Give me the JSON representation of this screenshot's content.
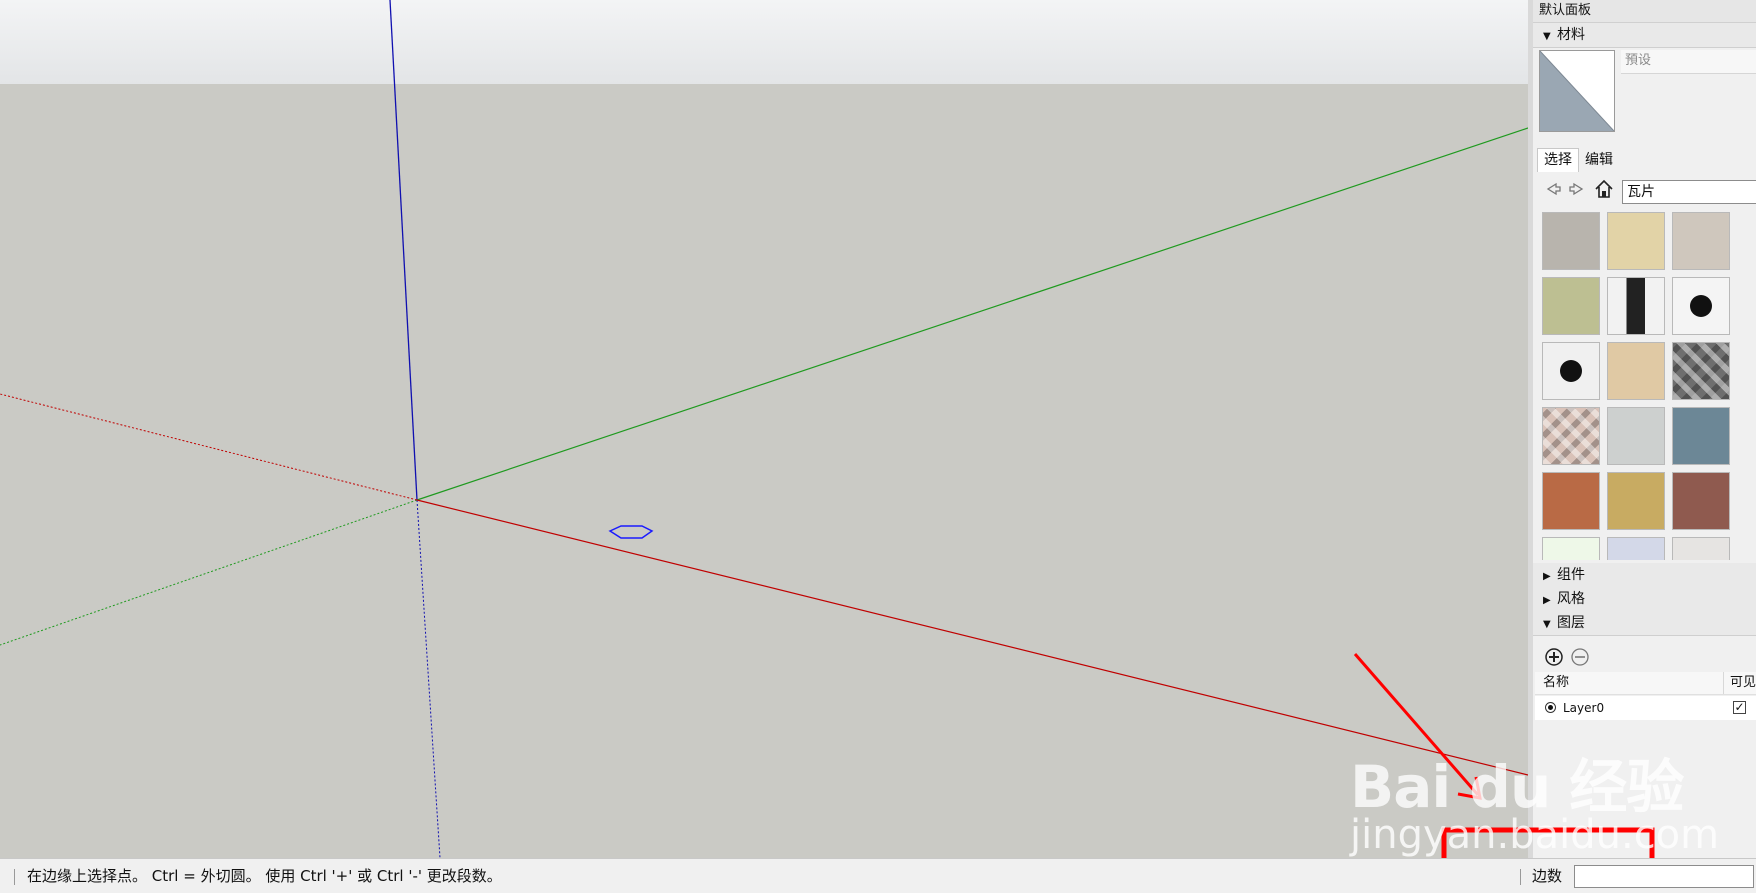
{
  "panel": {
    "title": "默认面板",
    "materials": {
      "header": "材料",
      "preset_placeholder": "預设",
      "tabs": [
        "选择",
        "编辑"
      ],
      "library": "瓦片",
      "nav_icons": [
        "back-arrow-icon",
        "forward-arrow-icon",
        "home-icon"
      ],
      "swatches": [
        {
          "kind": "stone-gray",
          "color": "#b8b4ad"
        },
        {
          "kind": "sand-tile",
          "color": "#e2d3a7"
        },
        {
          "kind": "stone-block",
          "color": "#cfc7bd"
        },
        {
          "kind": "green-linen",
          "color": "#bdbf92"
        },
        {
          "kind": "black-marble-pattern",
          "color": "#2b2b2b"
        },
        {
          "kind": "black-flower-white",
          "color": "#f4f4f4"
        },
        {
          "kind": "black-star-white",
          "color": "#f0f0f0"
        },
        {
          "kind": "beige-stone",
          "color": "#e0c9a4"
        },
        {
          "kind": "gray-diamond-pattern",
          "color": "#6e6e6e"
        },
        {
          "kind": "pink-green-star",
          "color": "#d9c2b8"
        },
        {
          "kind": "gray-granite",
          "color": "#cdd0cf"
        },
        {
          "kind": "blue-gray-stone",
          "color": "#6c8796"
        },
        {
          "kind": "terracotta",
          "color": "#b96a45"
        },
        {
          "kind": "ochre-tile",
          "color": "#c8ab62"
        },
        {
          "kind": "red-mosaic",
          "color": "#8f5a4f"
        },
        {
          "kind": "pale-green",
          "color": "#eef8e8"
        },
        {
          "kind": "blue-marble",
          "color": "#d3d8e8"
        },
        {
          "kind": "white-marble",
          "color": "#e6e4e2"
        }
      ]
    },
    "components_header": "组件",
    "styles_header": "风格",
    "layers": {
      "header": "图层",
      "tool_icons": [
        "add-layer-icon",
        "remove-layer-icon"
      ],
      "col_name": "名称",
      "col_visible": "可见",
      "rows": [
        {
          "name": "Layer0",
          "visible": true
        }
      ]
    }
  },
  "status": {
    "message": "在边缘上选择点。 Ctrl = 外切圆。 使用 Ctrl '+' 或 Ctrl '-' 更改段数。",
    "vcb_label": "边数",
    "vcb_value": ""
  },
  "watermark": {
    "brand": "Bai du 经验",
    "url": "jingyan.baidu.com"
  },
  "colors": {
    "axis_red": "#c00000",
    "axis_green": "#1f9a1f",
    "axis_blue": "#1010b0",
    "annotation_red": "#ff0000",
    "polygon_blue": "#1a1aff"
  }
}
